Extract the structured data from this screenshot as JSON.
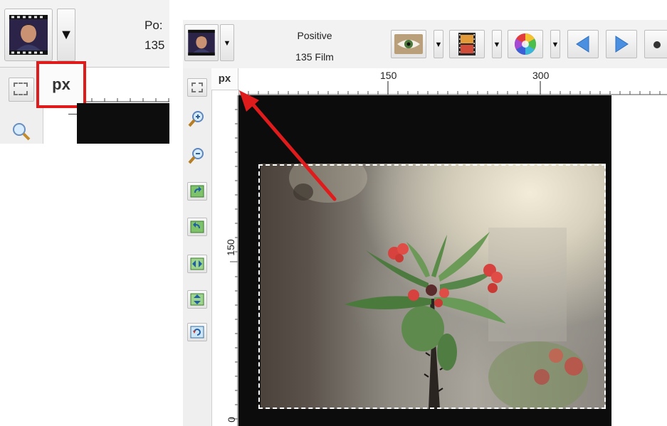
{
  "inset": {
    "positive_partial": "Po:",
    "film_partial": "135",
    "px_label": "px",
    "drop_arrow": "▼"
  },
  "toolbar": {
    "film_dropdown_arrow": "▼",
    "positive_label": "Positive",
    "film_label": "135 Film",
    "small_arrow": "▼"
  },
  "ruler": {
    "unit": "px",
    "h_ticks": [
      "150",
      "300"
    ],
    "v_ticks": [
      "150",
      "0"
    ]
  },
  "colors": {
    "highlight": "#e01b1b",
    "arrow": "#e01b1b",
    "toolbar_bg": "#f2f2f2",
    "canvas_bg": "#0c0c0c"
  }
}
